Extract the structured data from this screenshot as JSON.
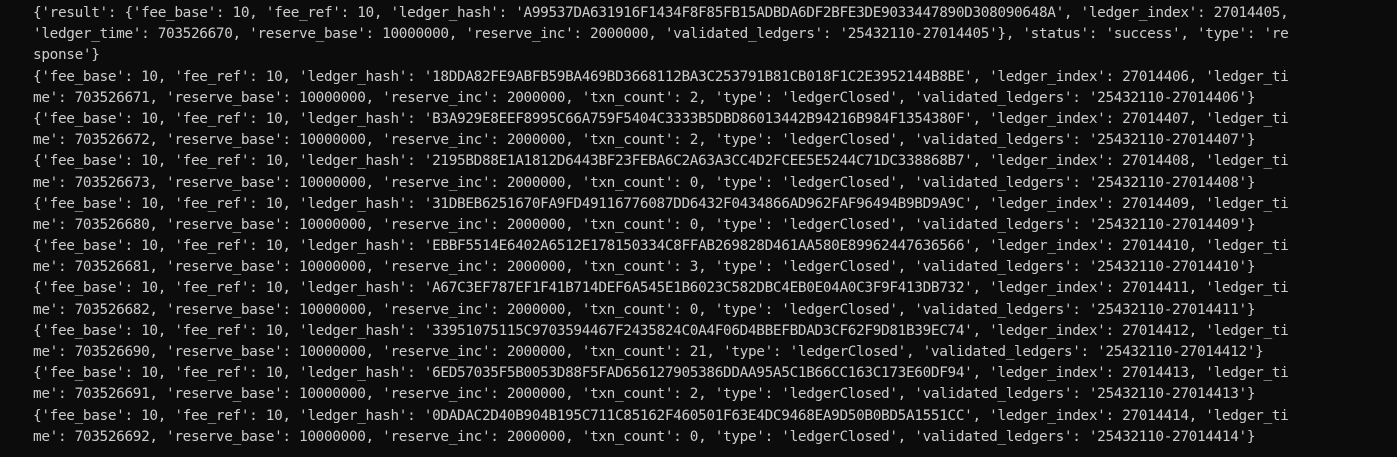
{
  "terminal": {
    "lines": [
      "{'result': {'fee_base': 10, 'fee_ref': 10, 'ledger_hash': 'A99537DA631916F1434F8F85FB15ADBDA6DF2BFE3DE9033447890D308090648A', 'ledger_index': 27014405,",
      "'ledger_time': 703526670, 'reserve_base': 10000000, 'reserve_inc': 2000000, 'validated_ledgers': '25432110-27014405'}, 'status': 'success', 'type': 're",
      "sponse'}",
      "{'fee_base': 10, 'fee_ref': 10, 'ledger_hash': '18DDA82FE9ABFB59BA469BD3668112BA3C253791B81CB018F1C2E3952144B8BE', 'ledger_index': 27014406, 'ledger_ti",
      "me': 703526671, 'reserve_base': 10000000, 'reserve_inc': 2000000, 'txn_count': 2, 'type': 'ledgerClosed', 'validated_ledgers': '25432110-27014406'}",
      "{'fee_base': 10, 'fee_ref': 10, 'ledger_hash': 'B3A929E8EEF8995C66A759F5404C3333B5DBD86013442B94216B984F1354380F', 'ledger_index': 27014407, 'ledger_ti",
      "me': 703526672, 'reserve_base': 10000000, 'reserve_inc': 2000000, 'txn_count': 2, 'type': 'ledgerClosed', 'validated_ledgers': '25432110-27014407'}",
      "{'fee_base': 10, 'fee_ref': 10, 'ledger_hash': '2195BD88E1A1812D6443BF23FEBA6C2A63A3CC4D2FCEE5E5244C71DC338868B7', 'ledger_index': 27014408, 'ledger_ti",
      "me': 703526673, 'reserve_base': 10000000, 'reserve_inc': 2000000, 'txn_count': 0, 'type': 'ledgerClosed', 'validated_ledgers': '25432110-27014408'}",
      "{'fee_base': 10, 'fee_ref': 10, 'ledger_hash': '31DBEB6251670FA9FD49116776087DD6432F0434866AD962FAF96494B9BD9A9C', 'ledger_index': 27014409, 'ledger_ti",
      "me': 703526680, 'reserve_base': 10000000, 'reserve_inc': 2000000, 'txn_count': 0, 'type': 'ledgerClosed', 'validated_ledgers': '25432110-27014409'}",
      "{'fee_base': 10, 'fee_ref': 10, 'ledger_hash': 'EBBF5514E6402A6512E178150334C8FFAB269828D461AA580E89962447636566', 'ledger_index': 27014410, 'ledger_ti",
      "me': 703526681, 'reserve_base': 10000000, 'reserve_inc': 2000000, 'txn_count': 3, 'type': 'ledgerClosed', 'validated_ledgers': '25432110-27014410'}",
      "{'fee_base': 10, 'fee_ref': 10, 'ledger_hash': 'A67C3EF787EF1F41B714DEF6A545E1B6023C582DBC4EB0E04A0C3F9F413DB732', 'ledger_index': 27014411, 'ledger_ti",
      "me': 703526682, 'reserve_base': 10000000, 'reserve_inc': 2000000, 'txn_count': 0, 'type': 'ledgerClosed', 'validated_ledgers': '25432110-27014411'}",
      "{'fee_base': 10, 'fee_ref': 10, 'ledger_hash': '33951075115C9703594467F2435824C0A4F06D4BBEFBDAD3CF62F9D81B39EC74', 'ledger_index': 27014412, 'ledger_ti",
      "me': 703526690, 'reserve_base': 10000000, 'reserve_inc': 2000000, 'txn_count': 21, 'type': 'ledgerClosed', 'validated_ledgers': '25432110-27014412'}",
      "{'fee_base': 10, 'fee_ref': 10, 'ledger_hash': '6ED57035F5B0053D88F5FAD656127905386DDAA95A5C1B66CC163C173E60DF94', 'ledger_index': 27014413, 'ledger_ti",
      "me': 703526691, 'reserve_base': 10000000, 'reserve_inc': 2000000, 'txn_count': 2, 'type': 'ledgerClosed', 'validated_ledgers': '25432110-27014413'}",
      "{'fee_base': 10, 'fee_ref': 10, 'ledger_hash': '0DADAC2D40B904B195C711C85162F460501F63E4DC9468EA9D50B0BD5A1551CC', 'ledger_index': 27014414, 'ledger_ti",
      "me': 703526692, 'reserve_base': 10000000, 'reserve_inc': 2000000, 'txn_count': 0, 'type': 'ledgerClosed', 'validated_ledgers': '25432110-27014414'}"
    ]
  }
}
